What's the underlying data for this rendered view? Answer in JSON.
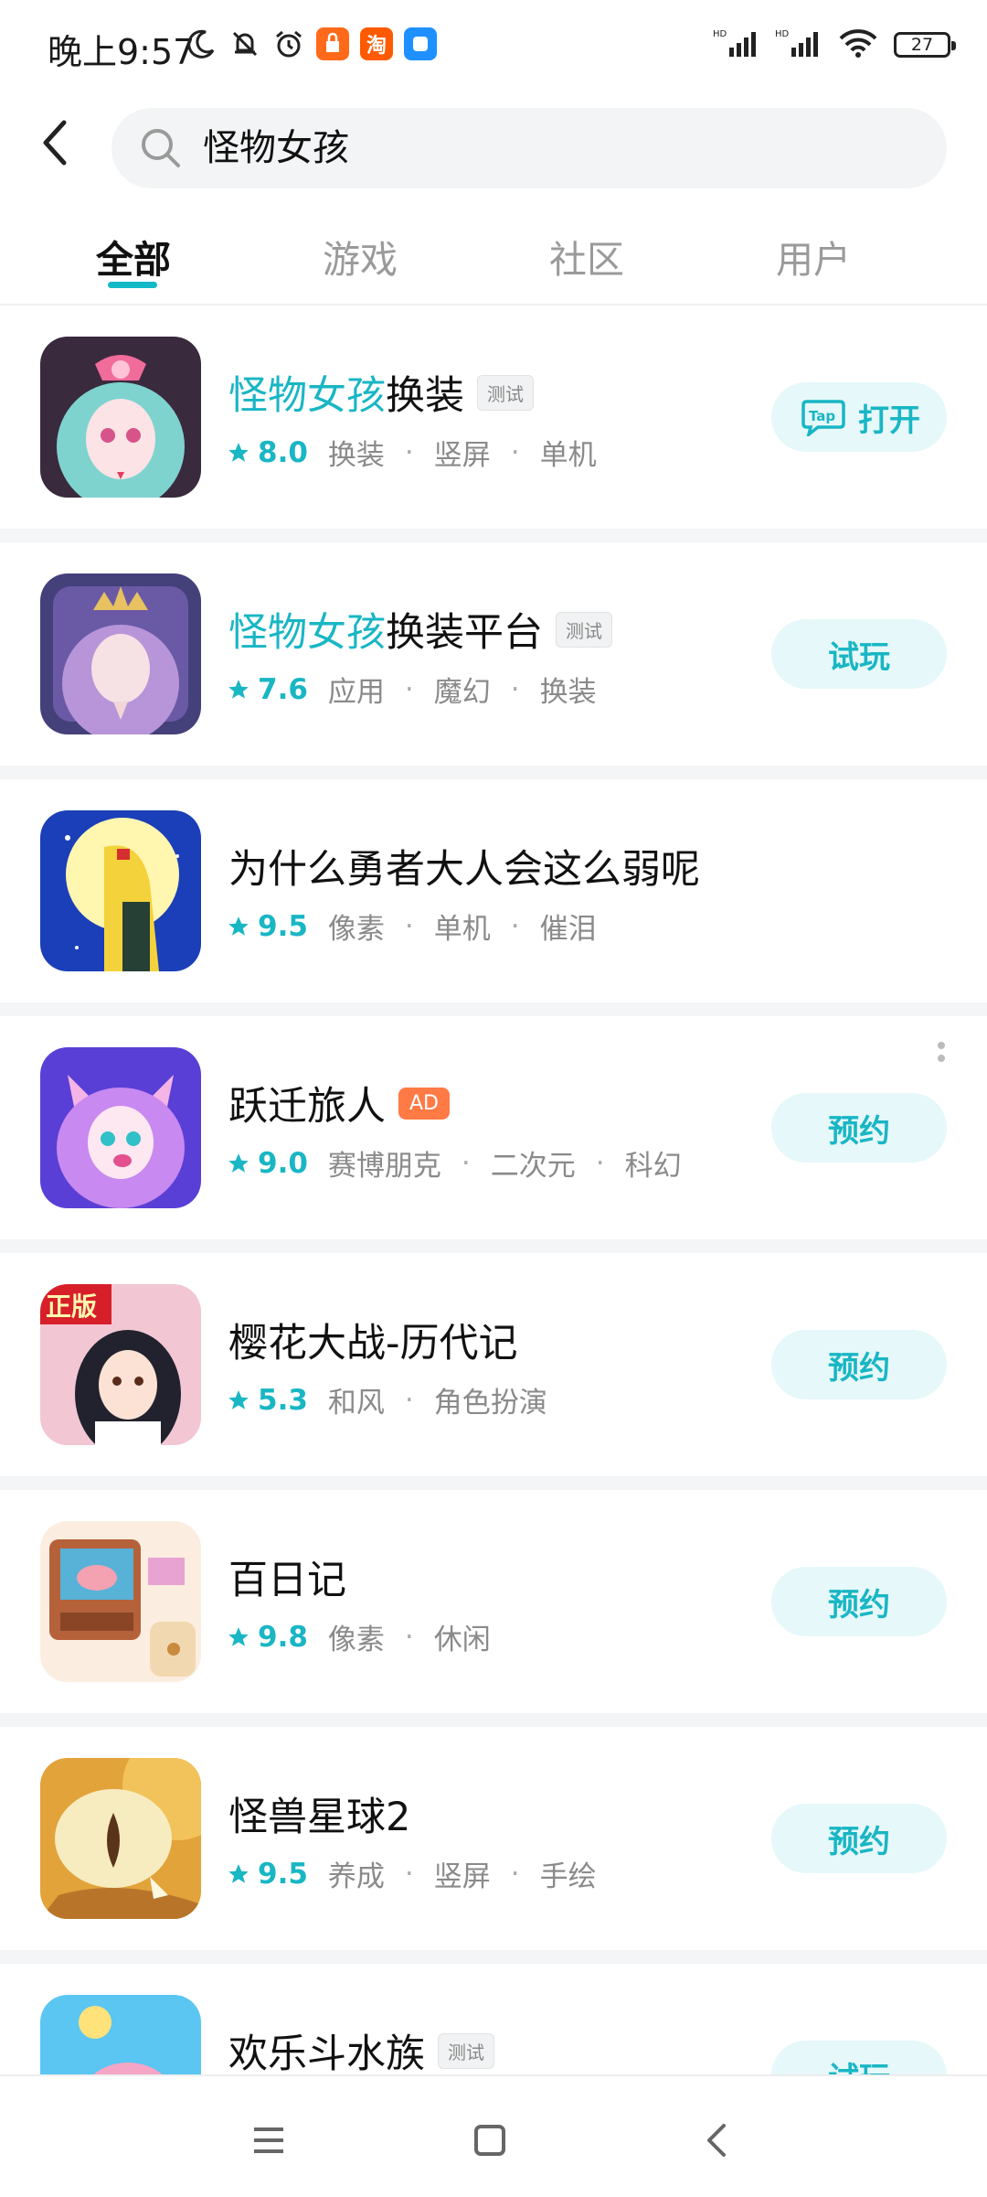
{
  "status_bar": {
    "time": "晚上9:57",
    "battery": "27",
    "taobao_label": "淘"
  },
  "search": {
    "query": "怪物女孩"
  },
  "tabs": [
    {
      "label": "全部",
      "active": true
    },
    {
      "label": "游戏",
      "active": false
    },
    {
      "label": "社区",
      "active": false
    },
    {
      "label": "用户",
      "active": false
    }
  ],
  "results": [
    {
      "title_highlight": "怪物女孩",
      "title_rest": "换装",
      "tag": "测试",
      "score": "8.0",
      "tags": [
        "换装",
        "竖屏",
        "单机"
      ],
      "button": "打开"
    },
    {
      "title_highlight": "怪物女孩",
      "title_rest": "换装平台",
      "tag": "测试",
      "score": "7.6",
      "tags": [
        "应用",
        "魔幻",
        "换装"
      ],
      "button": "试玩"
    },
    {
      "title": "为什么勇者大人会这么弱呢",
      "score": "9.5",
      "tags": [
        "像素",
        "单机",
        "催泪"
      ]
    },
    {
      "title": "跃迁旅人",
      "ad_tag": "AD",
      "score": "9.0",
      "tags": [
        "赛博朋克",
        "二次元",
        "科幻"
      ],
      "button": "预约"
    },
    {
      "title": "樱花大战-历代记",
      "icon_badge": "正版",
      "score": "5.3",
      "tags": [
        "和风",
        "角色扮演"
      ],
      "button": "预约"
    },
    {
      "title": "百日记",
      "score": "9.8",
      "tags": [
        "像素",
        "休闲"
      ],
      "button": "预约"
    },
    {
      "title": "怪兽星球2",
      "score": "9.5",
      "tags": [
        "养成",
        "竖屏",
        "手绘"
      ],
      "button": "预约"
    },
    {
      "title": "欢乐斗水族",
      "tag": "测试",
      "button": "试玩"
    }
  ],
  "colors": {
    "accent": "#19b6c4",
    "button_bg": "#e6f8f9",
    "ad_tag": "#ff7a45"
  }
}
